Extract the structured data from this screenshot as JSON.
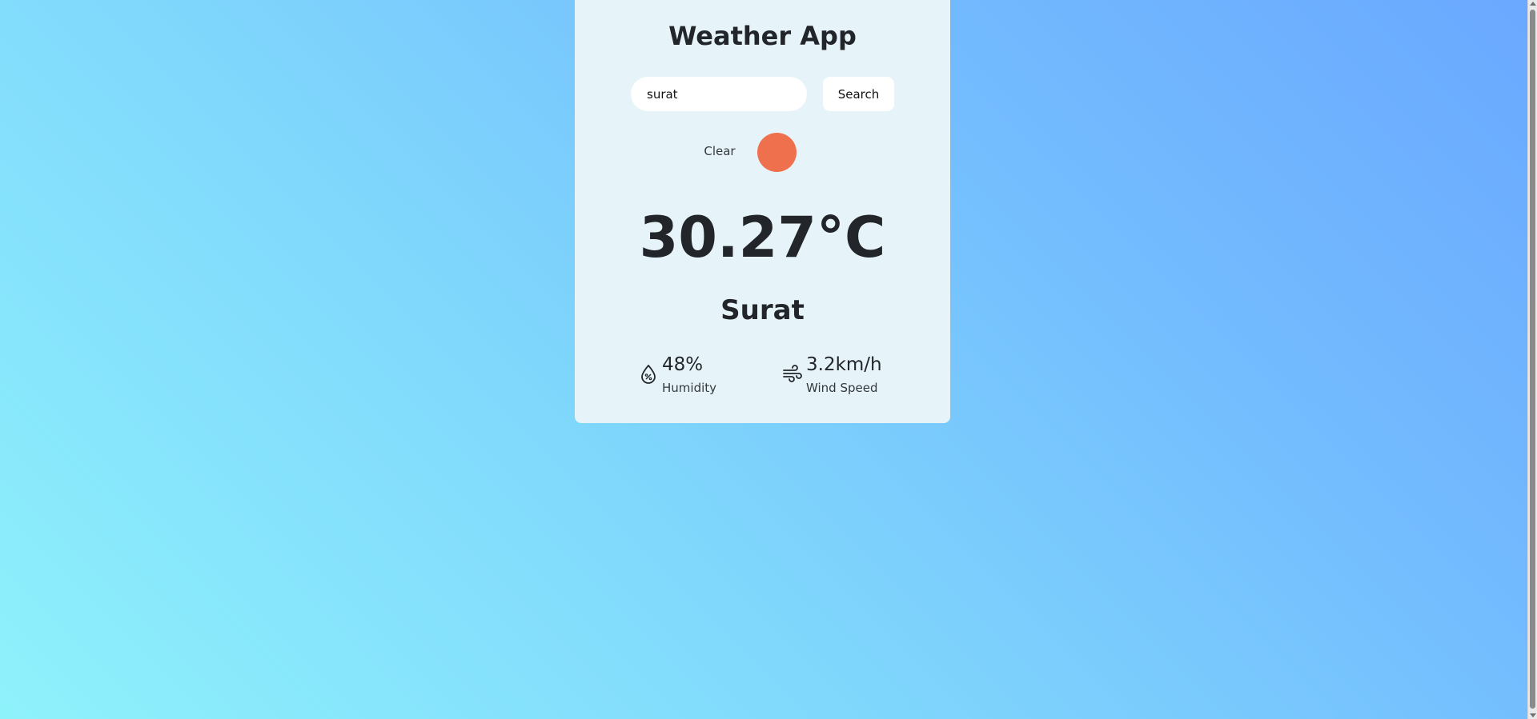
{
  "app": {
    "title": "Weather App"
  },
  "search": {
    "value": "surat",
    "button_label": "Search"
  },
  "condition": {
    "label": "Clear",
    "icon": "sun-icon",
    "icon_color": "#ef704c"
  },
  "weather": {
    "temperature": "30.27°C",
    "city": "Surat"
  },
  "stats": {
    "humidity": {
      "value": "48%",
      "label": "Humidity",
      "icon": "humidity-drop-icon"
    },
    "wind": {
      "value": "3.2km/h",
      "label": "Wind Speed",
      "icon": "wind-icon"
    }
  },
  "colors": {
    "card_background": "#e6f4f9",
    "page_gradient_start": "#8ef2fb",
    "page_gradient_end": "#6aa8ff"
  }
}
